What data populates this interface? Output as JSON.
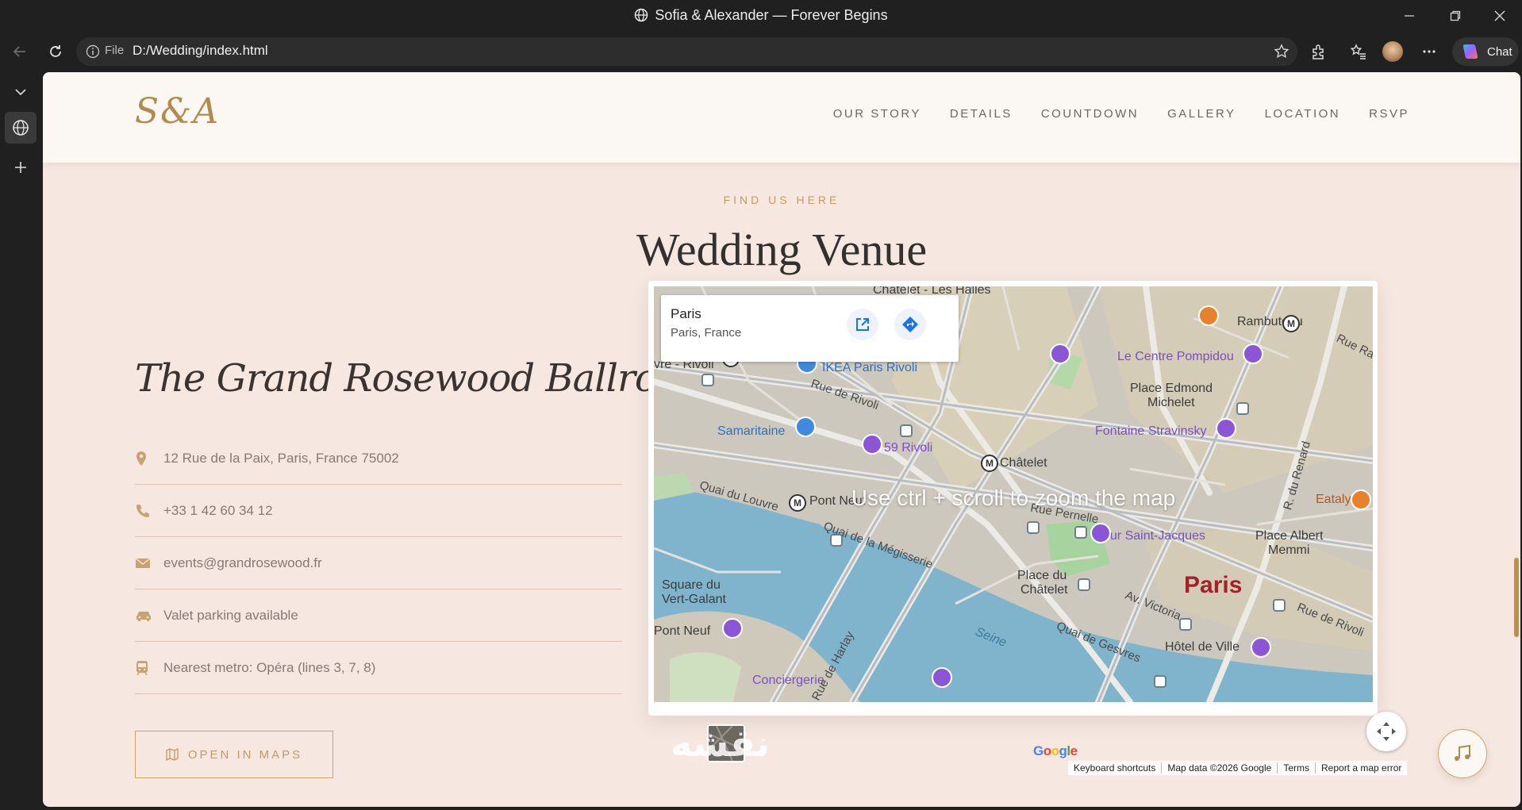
{
  "browser": {
    "window_title": "Sofia & Alexander — Forever Begins",
    "address_label": "File",
    "url": "D:/Wedding/index.html",
    "chat_label": "Chat"
  },
  "site": {
    "logo": "S&A",
    "nav": [
      "OUR STORY",
      "DETAILS",
      "COUNTDOWN",
      "GALLERY",
      "LOCATION",
      "RSVP"
    ]
  },
  "section": {
    "eyebrow": "FIND US HERE",
    "title": "Wedding Venue"
  },
  "venue": {
    "name": "The Grand Rosewood Ballroom",
    "details": [
      {
        "icon": "location-pin-icon",
        "text": "12 Rue de la Paix, Paris, France 75002"
      },
      {
        "icon": "phone-icon",
        "text": "+33 1 42 60 34 12"
      },
      {
        "icon": "envelope-icon",
        "text": "events@grandrosewood.fr"
      },
      {
        "icon": "car-icon",
        "text": "Valet parking available"
      },
      {
        "icon": "metro-train-icon",
        "text": "Nearest metro: Opéra (lines 3, 7, 8)"
      }
    ],
    "open_maps_label": "OPEN IN MAPS"
  },
  "map": {
    "place_name": "Paris",
    "place_address": "Paris, France",
    "zoom_hint": "Use ctrl + scroll to zoom the map",
    "google_logo": "Google",
    "footer": [
      "Keyboard shortcuts",
      "Map data ©2026 Google",
      "Terms",
      "Report a map error"
    ],
    "labels": {
      "chatelet_les_halles": "Chatelet - Les Halles",
      "ikea": "IKEA Paris Rivoli",
      "rambuteau": "Rambuteau",
      "centre_pompidou": "Le Centre Pompidou",
      "place_edmond": "Place Edmond",
      "michelet": "Michelet",
      "rue_de_rivoli": "Rue de Rivoli",
      "samaritaine": "Samaritaine",
      "rivoli_59": "59 Rivoli",
      "chatelet": "Châtelet",
      "fontaine_stravinsky": "Fontaine Stravinsky",
      "quai_du_louvre": "Quai du Louvre",
      "pont_neuf": "Pont Neuf",
      "rue_pernelle": "Rue Pernelle",
      "tour_saint_jacques": "Tour Saint-Jacques",
      "place_albert": "Place Albert",
      "memmi": "Memmi",
      "eataly": "Eataly",
      "quai_megisserie": "Quai de la Mégisserie",
      "place_du": "Place du",
      "chatelet2": "Châtelet",
      "paris": "Paris",
      "square_du": "Square du",
      "vert_galant": "Vert-Galant",
      "av_victoria": "Av. Victoria",
      "rue_de_rivoli2": "Rue de Rivoli",
      "pont_neuf2": "Pont Neuf",
      "seine": "Seine",
      "quai_de_gesvres": "Quai de Gesvres",
      "hotel_de_ville": "Hôtel de Ville",
      "conciergerie": "Conciergerie",
      "rue_de_harlay": "Rue de Harlay",
      "rue_du_renard": "R. du Renard",
      "rue_ram": "Rue Ram",
      "rue_rivoli_left": "vre - Rivoli"
    }
  },
  "colors": {
    "accent_gold": "#c39a63",
    "page_bg": "#f6e7e1",
    "header_bg": "#fbf7f3"
  }
}
